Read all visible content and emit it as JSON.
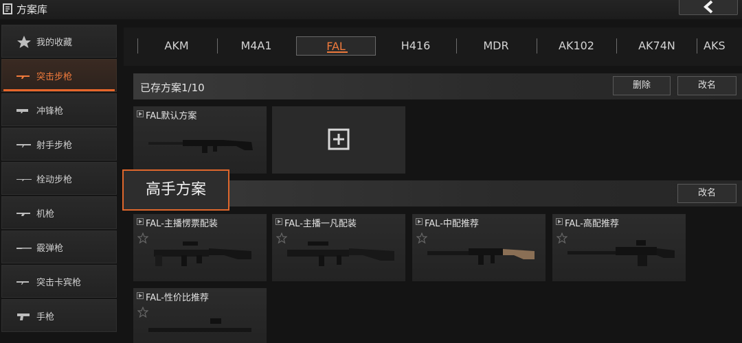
{
  "header": {
    "title": "方案库",
    "back_icon": "chevron-left-icon"
  },
  "sidebar": {
    "items": [
      {
        "label": "我的收藏",
        "icon": "star-icon",
        "active": false
      },
      {
        "label": "突击步枪",
        "icon": "assault-rifle-icon",
        "active": true
      },
      {
        "label": "冲锋枪",
        "icon": "smg-icon",
        "active": false
      },
      {
        "label": "射手步枪",
        "icon": "dmr-icon",
        "active": false
      },
      {
        "label": "栓动步枪",
        "icon": "sniper-icon",
        "active": false
      },
      {
        "label": "机枪",
        "icon": "lmg-icon",
        "active": false
      },
      {
        "label": "霰弹枪",
        "icon": "shotgun-icon",
        "active": false
      },
      {
        "label": "突击卡宾枪",
        "icon": "carbine-icon",
        "active": false
      },
      {
        "label": "手枪",
        "icon": "pistol-icon",
        "active": false
      }
    ],
    "accent": "#e8662a"
  },
  "tabs": {
    "items": [
      "AKM",
      "M4A1",
      "FAL",
      "H416",
      "MDR",
      "AK102",
      "AK74N",
      "AKS"
    ],
    "selected": "FAL"
  },
  "saved": {
    "title": "已存方案1/10",
    "delete_label": "删除",
    "rename_label": "改名",
    "cards": [
      {
        "name": "FAL默认方案"
      }
    ]
  },
  "pro": {
    "title": "高手方案",
    "rename_label": "改名",
    "cards": [
      {
        "name": "FAL-主播愣票配装"
      },
      {
        "name": "FAL-主播一凡配装"
      },
      {
        "name": "FAL-中配推荐"
      },
      {
        "name": "FAL-高配推荐"
      },
      {
        "name": "FAL-性价比推荐"
      }
    ]
  }
}
